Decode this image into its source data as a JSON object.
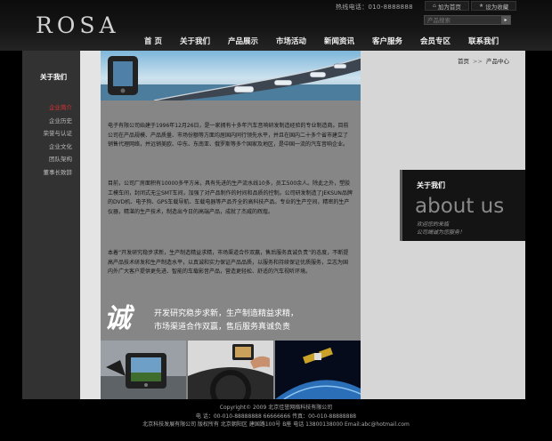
{
  "header": {
    "logo": "ROSA",
    "hotline": "热线电话：010-8888888",
    "links": [
      {
        "label": "加为首页",
        "icon": "home-icon"
      },
      {
        "label": "设为收藏",
        "icon": "favorite-icon"
      }
    ],
    "search": {
      "placeholder": "产品搜索",
      "value": "",
      "button_icon": "arrow-right-icon"
    },
    "nav": [
      "首 页",
      "关于我们",
      "产品展示",
      "市场活动",
      "新闻资讯",
      "客户服务",
      "会员专区",
      "联系我们"
    ]
  },
  "sidebar": {
    "title": "关于我们",
    "items": [
      "企业简介",
      "企业历史",
      "荣誉与认证",
      "企业文化",
      "团队架构",
      "董事长致辞"
    ],
    "active_index": 0
  },
  "breadcrumb": {
    "home": "首页",
    "separator": ">>",
    "current": "产品中心"
  },
  "content": {
    "paragraphs": [
      "电子有限公司始建于1996年12月26日，是一家拥有十多年汽车音响研发制造经验的专业制造商。目前公司在产品规模、产品质量、市场份额等方面均居国内同行领先水平，并且在国内二十多个省市建立了销售代理网络，并远销美欧、中东、东南亚、俄罗斯等多个国家及地区，是中国一流的汽车音响企业。",
      "目前，公司厂房面积有10000多平方米，具有先进的生产流水线10多，员工500余人。除此之外，塑胶工模车间，封闭式无尘SMT车间，加强了对产品制作的时间和品质的控制。公司研发制造了JEKSUN品牌的DVD机、电子狗、GPS车载导航、车载电器等产品齐全的高科技产品。专业的生产空间，精密的生产仪器，精湛的生产技术，制造出今日的高端产品，成就了杰威的辉煌。",
      "本着“开发研究稳步求新，生产制造精益求精，市场渠道合作双赢，售后服务真诚负责”的态度，不断提高产品技术研发和生产制造水平，以真诚和实力保证产品品质，以服务和持续保证优质服务，立志为国内外广大客户提供更先进、智能的车载影音产品，营造更轻松、舒适的汽车视听环境。"
    ],
    "slogan": {
      "char": "诚",
      "line1": "开发研究稳步求新，生产制造精益求精，",
      "line2": "市场渠道合作双赢，售后服务真诚负责"
    }
  },
  "about_box": {
    "title": "关于我们",
    "english": "about us",
    "sub1": "欢迎您的来临",
    "sub2": "公司竭诚为您服务！"
  },
  "footer": {
    "line1": "Copyright© 2009 北京佳誉网络科技有限公司",
    "line2": "电 话：00-010-88888888 66666666 传真：00-010-88888888",
    "line3": "北京科技发展有限公司 版权所有 北京朝阳区 建国路100号 B座 电话 13800138000 Email:abc@hotmail.com"
  },
  "colors": {
    "accent_red": "#e03030",
    "content_bg": "#868686",
    "sidebar_bg": "#323232"
  }
}
